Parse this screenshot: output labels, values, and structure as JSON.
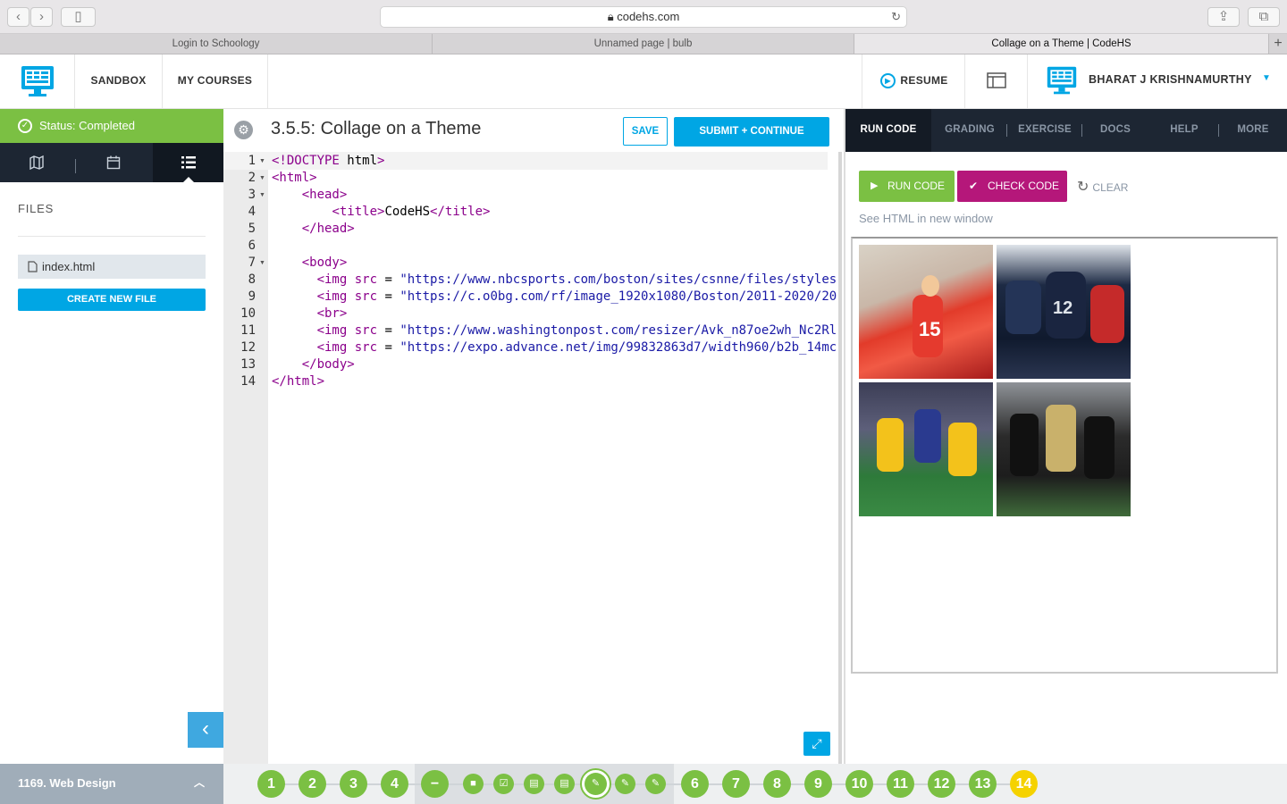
{
  "browser": {
    "url": "codehs.com",
    "tabs": [
      "Login to Schoology",
      "Unnamed page | bulb",
      "Collage on a Theme | CodeHS"
    ]
  },
  "header": {
    "nav": [
      "SANDBOX",
      "MY COURSES"
    ],
    "resume": "RESUME",
    "user": "BHARAT J KRISHNAMURTHY"
  },
  "left": {
    "status": "Status: Completed",
    "files_heading": "FILES",
    "file": "index.html",
    "create": "CREATE NEW FILE",
    "course": "1169. Web Design"
  },
  "editor": {
    "title": "3.5.5: Collage on a Theme",
    "save": "SAVE",
    "submit": "SUBMIT + CONTINUE",
    "line_numbers": [
      "1",
      "2",
      "3",
      "4",
      "5",
      "6",
      "7",
      "8",
      "9",
      "10",
      "11",
      "12",
      "13",
      "14"
    ],
    "lines": [
      "<!DOCTYPE html>",
      "<html>",
      "    <head>",
      "        <title>CodeHS</title>",
      "    </head>",
      "",
      "    <body>",
      "      <img src = \"https://www.nbcsports.com/boston/sites/csnne/files/styles",
      "      <img src = \"https://c.o0bg.com/rf/image_1920x1080/Boston/2011-2020/20",
      "      <br>",
      "      <img src = \"https://www.washingtonpost.com/resizer/Avk_n87oe2wh_Nc2Rl",
      "      <img src = \"https://expo.advance.net/img/99832863d7/width960/b2b_14mc",
      "    </body>",
      "</html>"
    ]
  },
  "right": {
    "tabs": [
      "RUN CODE",
      "GRADING",
      "EXERCISE",
      "DOCS",
      "HELP",
      "MORE"
    ],
    "run": "RUN CODE",
    "check": "CHECK CODE",
    "clear": "CLEAR",
    "see_html": "See HTML in new window"
  },
  "steps": [
    "1",
    "2",
    "3",
    "4",
    "6",
    "7",
    "8",
    "9",
    "10",
    "11",
    "12",
    "13",
    "14"
  ],
  "colors": {
    "green": "#7bc043",
    "blue": "#00a6e4",
    "magenta": "#b5177a",
    "dark": "#1d2633",
    "yellow": "#f5d200"
  }
}
